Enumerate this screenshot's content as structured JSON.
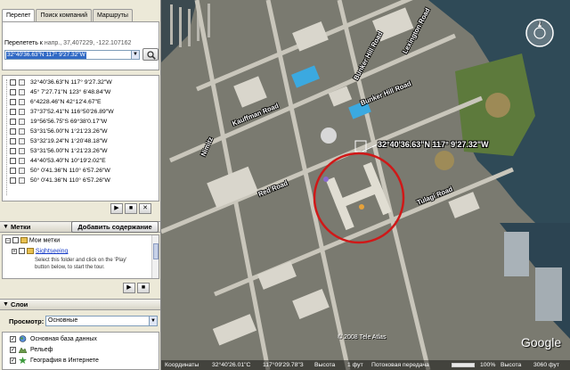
{
  "tabs": [
    "Перелет",
    "Поиск компаний",
    "Маршруты"
  ],
  "fly_to": {
    "label": "Перелететь к",
    "hint": "напр., 37,407229, -122.107162",
    "value": "32°40'36.63\"N 117° 9'27.32\"W"
  },
  "results": [
    "32°40'36.63\"N 117° 9'27.32\"W",
    "45° 7'27.71\"N 123° 6'48.84\"W",
    "6°4228.46\"N 42°12'4.67\"E",
    "37°37'52.41\"N 116°50'26.89\"W",
    "19°56'56.75\"S 69°38'0.17\"W",
    "53°31'56.00\"N 1°21'23.26\"W",
    "53°32'19.24\"N 1°20'48.18\"W",
    "53°31'56.00\"N 1°21'23.26\"W",
    "44°40'53.40\"N 10°19'2.02\"E",
    "50° 0'41.36\"N 110° 6'57.26\"W",
    "50° 0'41.36\"N 110° 6'57.26\"W"
  ],
  "controls": {
    "play": "▶",
    "stop": "■",
    "close": "✕"
  },
  "places_panel": {
    "title": "Метки",
    "add_content": "Добавить содержание",
    "root": "Мои метки",
    "item": "Sightseeing",
    "description": [
      "Select this folder and click on the 'Play'",
      "button below, to start the tour."
    ]
  },
  "layers_panel": {
    "title": "Слои",
    "view_label": "Просмотр:",
    "view_value": "Основные",
    "items": [
      "Основная база данных",
      "Рельеф",
      "География в Интернете"
    ]
  },
  "map": {
    "placemark_label": "32°40'36.63\"N 117° 9'27.32\"W",
    "streets": [
      "Kauffman Road",
      "Bunker Hill Road",
      "Lexington Road",
      "Bunker Hill Road",
      "Red Road",
      "Tulagi Road",
      "Nimitz"
    ],
    "copyright": "© 2008 Tele Atlas",
    "logo": "Google",
    "highlight_color": "#d01818"
  },
  "status": {
    "coords_label": "Координаты",
    "coords": "32°40'26.01\"C",
    "coords2": "117°09'29.78\"3",
    "alt_label": "Высота",
    "alt_value": "1 фут",
    "stream_label": "Потоковая передача",
    "stream_pct": 100,
    "stream_value": "100%",
    "eye_label": "Высота",
    "eye_value": "3060 фут"
  }
}
